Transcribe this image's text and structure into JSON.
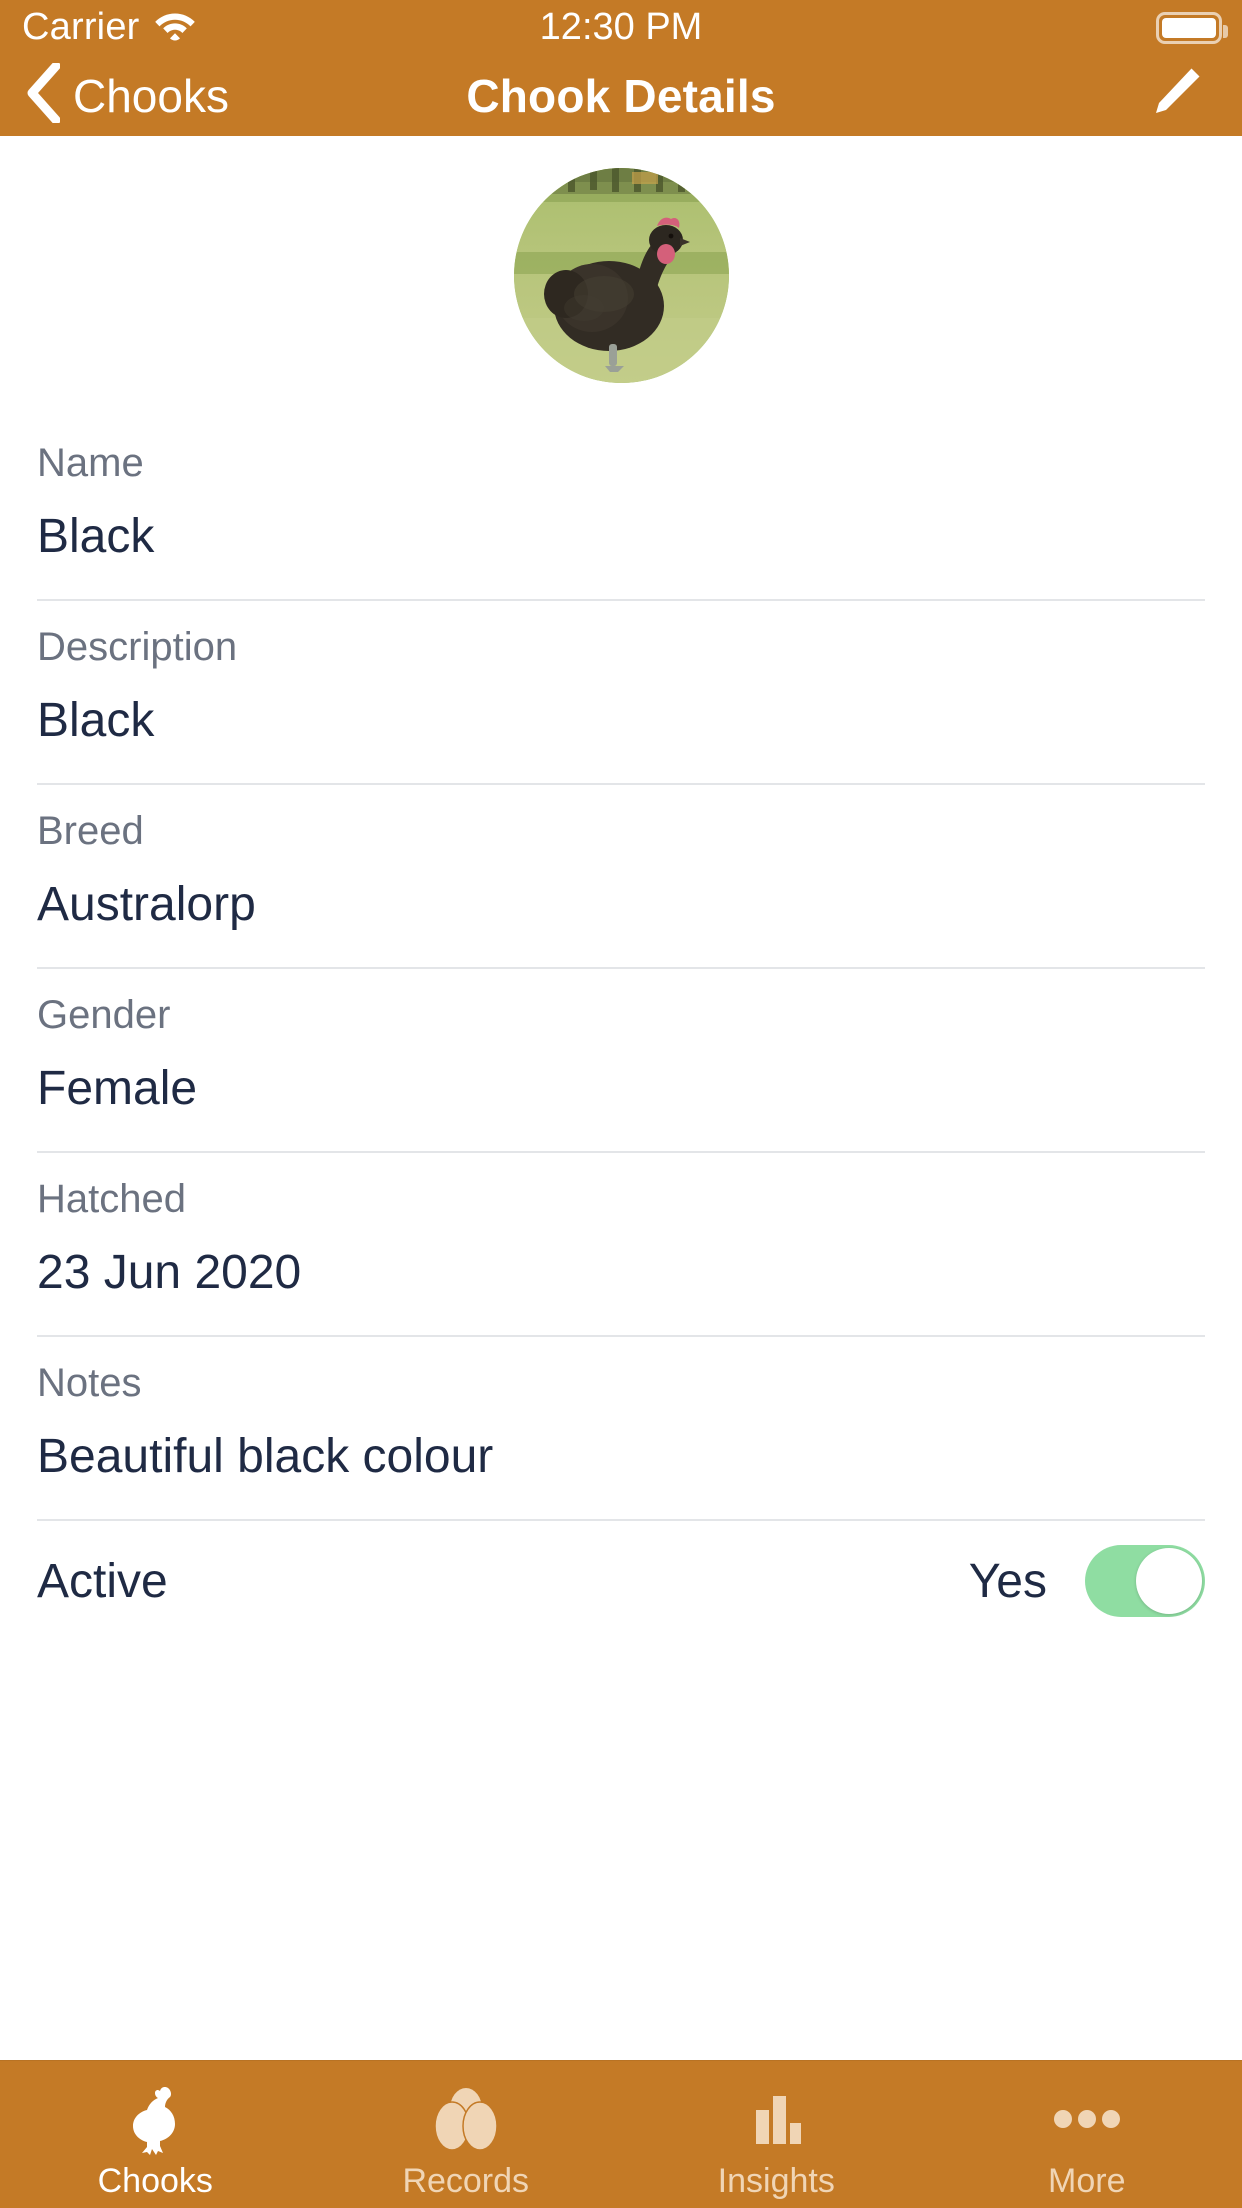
{
  "status_bar": {
    "carrier": "Carrier",
    "wifi_icon": "wifi-icon",
    "time": "12:30 PM",
    "battery_icon": "battery-full-icon"
  },
  "nav_bar": {
    "back_icon": "chevron-left-icon",
    "back_label": "Chooks",
    "title": "Chook Details",
    "edit_icon": "pencil-icon"
  },
  "avatar": {
    "name": "chook-photo-avatar",
    "alt": "Black Australorp hen standing on grass"
  },
  "fields": [
    {
      "label": "Name",
      "value": "Black"
    },
    {
      "label": "Description",
      "value": "Black"
    },
    {
      "label": "Breed",
      "value": "Australorp"
    },
    {
      "label": "Gender",
      "value": "Female"
    },
    {
      "label": "Hatched",
      "value": "23 Jun 2020"
    },
    {
      "label": "Notes",
      "value": "Beautiful black colour"
    }
  ],
  "active_row": {
    "label": "Active",
    "value": "Yes",
    "toggle_on": true
  },
  "tab_bar": {
    "items": [
      {
        "label": "Chooks",
        "icon": "chicken-icon",
        "active": true
      },
      {
        "label": "Records",
        "icon": "eggs-icon",
        "active": false
      },
      {
        "label": "Insights",
        "icon": "bar-chart-icon",
        "active": false
      },
      {
        "label": "More",
        "icon": "ellipsis-icon",
        "active": false
      }
    ]
  },
  "colors": {
    "brand": "#C47A26",
    "label_gray": "#6B7280",
    "value_navy": "#1F2A44",
    "divider": "#E3E5E8",
    "toggle_on": "#8FDDA2",
    "tab_inactive": "#F0D5B5"
  }
}
